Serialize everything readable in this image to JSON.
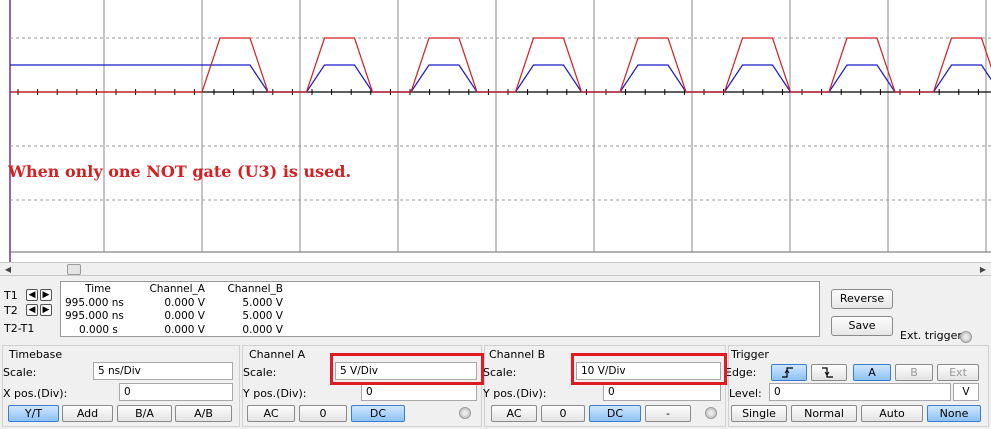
{
  "annotation": "When only one NOT gate (U3) is used.",
  "colors": {
    "channel_a": "#d42020",
    "channel_b": "#1a1ac8",
    "highlight": "#e01b24",
    "grid": "#9a9a9a"
  },
  "waveforms": {
    "channel_a_high_div": 2,
    "channel_b_high_div": 1,
    "pulse_count": 8
  },
  "readout": {
    "cursors": [
      "T1",
      "T2",
      "T2-T1"
    ],
    "headers": [
      "Time",
      "Channel_A",
      "Channel_B"
    ],
    "rows": [
      [
        "995.000 ns",
        "0.000 V",
        "5.000 V"
      ],
      [
        "995.000 ns",
        "0.000 V",
        "5.000 V"
      ],
      [
        "0.000 s",
        "0.000 V",
        "0.000 V"
      ]
    ]
  },
  "side": {
    "reverse": "Reverse",
    "save": "Save",
    "ext_trigger": "Ext. trigger"
  },
  "timebase": {
    "title": "Timebase",
    "scale_label": "Scale:",
    "scale_value": "5 ns/Div",
    "xpos_label": "X pos.(Div):",
    "xpos_value": "0",
    "buttons": [
      "Y/T",
      "Add",
      "B/A",
      "A/B"
    ]
  },
  "channel_a": {
    "title": "Channel A",
    "scale_label": "Scale:",
    "scale_value": "5  V/Div",
    "ypos_label": "Y pos.(Div):",
    "ypos_value": "0",
    "buttons": [
      "AC",
      "0",
      "DC"
    ]
  },
  "channel_b": {
    "title": "Channel B",
    "scale_label": "Scale:",
    "scale_value": "10  V/Div",
    "ypos_label": "Y pos.(Div):",
    "ypos_value": "0",
    "buttons": [
      "AC",
      "0",
      "DC",
      "-"
    ]
  },
  "trigger": {
    "title": "Trigger",
    "edge_label": "Edge:",
    "edge_rising": "rising-edge-icon",
    "edge_falling": "falling-edge-icon",
    "sources": [
      "A",
      "B",
      "Ext"
    ],
    "level_label": "Level:",
    "level_value": "0",
    "level_unit": "V",
    "modes": [
      "Single",
      "Normal",
      "Auto",
      "None"
    ]
  }
}
